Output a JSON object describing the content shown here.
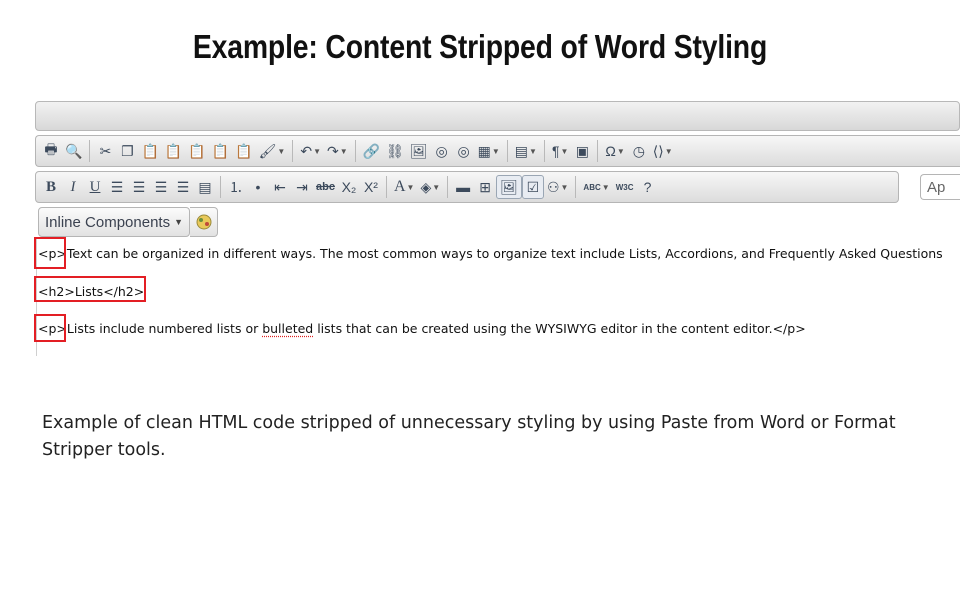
{
  "slide": {
    "title": "Example: Content Stripped of Word Styling",
    "caption": "Example of clean HTML code stripped of unnecessary styling by using Paste from Word or Format Stripper tools."
  },
  "toolbar": {
    "format": {
      "bold": "B",
      "italic": "I",
      "underline": "U",
      "strike": "abc",
      "subscript": "X₂",
      "superscript": "X²",
      "text_color": "A",
      "spellcheck": "ABC",
      "w3c": "W3C"
    },
    "styles_select": "Ap",
    "inline_components": "Inline Components"
  },
  "content": {
    "line1_tag": "<p>",
    "line1_text": "Text can be organized in different ways. The most common ways to organize text include Lists, Accordions, and Frequently Asked Questions",
    "line2_open": "<h2>",
    "line2_text": "Lists",
    "line2_close": "</h2>",
    "line3_tag": "<p>",
    "line3_before": "Lists include numbered lists or ",
    "line3_misspelled": "bulleted",
    "line3_after": " lists that can be created using the WYSIWYG editor in the content editor.</p>"
  },
  "colors": {
    "highlight": "#e31e24",
    "toolbar_bg": "#e4e4e4",
    "icon": "#3c4a5c"
  }
}
